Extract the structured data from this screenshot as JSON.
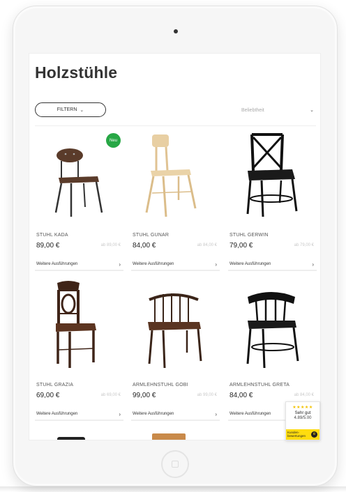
{
  "page": {
    "title": "Holzstühle"
  },
  "toolbar": {
    "filter_label": "FILTERN",
    "sort_label": "Beliebtheit"
  },
  "products": [
    {
      "name": "STUHL KADA",
      "price": "89,00 €",
      "old_price": "ab 89,00 €",
      "variants_label": "Weitere Ausführungen",
      "badge": "Neu"
    },
    {
      "name": "STUHL GUNAR",
      "price": "84,00 €",
      "old_price": "ab 84,00 €",
      "variants_label": "Weitere Ausführungen"
    },
    {
      "name": "STUHL GERWIN",
      "price": "79,00 €",
      "old_price": "ab 79,00 €",
      "variants_label": "Weitere Ausführungen"
    },
    {
      "name": "STUHL GRAZIA",
      "price": "69,00 €",
      "old_price": "ab 69,00 €",
      "variants_label": "Weitere Ausführungen"
    },
    {
      "name": "ARMLEHNSTUHL GOBI",
      "price": "99,00 €",
      "old_price": "ab 99,00 €",
      "variants_label": "Weitere Ausführungen"
    },
    {
      "name": "ARMLEHNSTUHL GRETA",
      "price": "84,00 €",
      "old_price": "ab 84,00 €",
      "variants_label": "Weitere Ausführungen"
    }
  ],
  "review_widget": {
    "stars": "★★★★★",
    "rating_text": "Sehr gut",
    "score": "4.89/5.00",
    "brand_text": "Kunden-\nbewertungen"
  },
  "colors": {
    "badge_new": "#27a745",
    "review_band": "#ffdc0f"
  }
}
